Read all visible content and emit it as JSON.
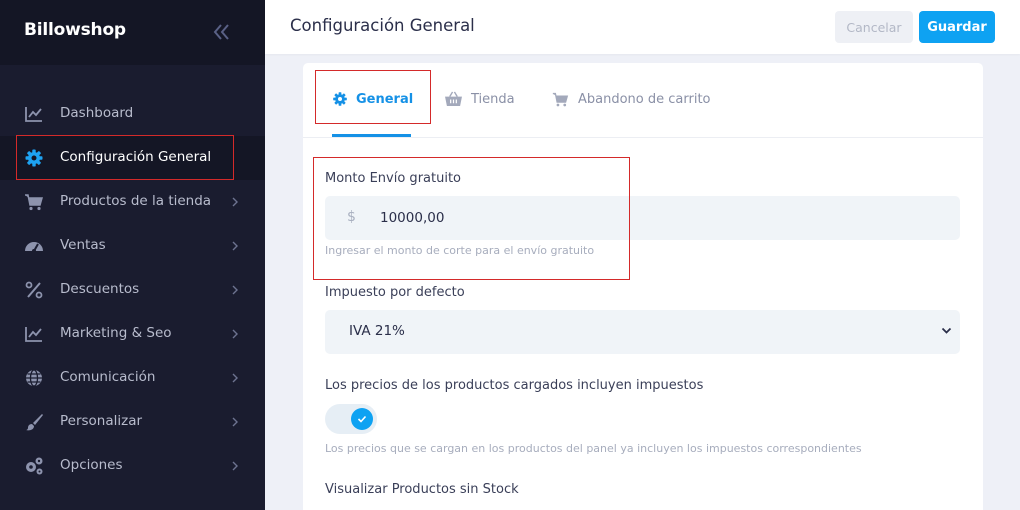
{
  "sidebar": {
    "brand": "Billowshop",
    "items": [
      {
        "label": "Dashboard",
        "icon": "chart-line-icon"
      },
      {
        "label": "Configuración General",
        "icon": "gear-icon"
      },
      {
        "label": "Productos de la tienda",
        "icon": "cart-icon"
      },
      {
        "label": "Ventas",
        "icon": "speedometer-icon"
      },
      {
        "label": "Descuentos",
        "icon": "percent-icon"
      },
      {
        "label": "Marketing & Seo",
        "icon": "chart-line-icon"
      },
      {
        "label": "Comunicación",
        "icon": "globe-icon"
      },
      {
        "label": "Personalizar",
        "icon": "brush-icon"
      },
      {
        "label": "Opciones",
        "icon": "gears-icon"
      }
    ],
    "active_index": 1
  },
  "header": {
    "title": "Configuración General",
    "cancel_label": "Cancelar",
    "save_label": "Guardar"
  },
  "tabs": [
    {
      "label": "General",
      "icon": "gear-icon",
      "active": true
    },
    {
      "label": "Tienda",
      "icon": "basket-icon",
      "active": false
    },
    {
      "label": "Abandono de carrito",
      "icon": "cart-icon",
      "active": false
    }
  ],
  "form": {
    "free_shipping": {
      "label": "Monto Envío gratuito",
      "currency_symbol": "$",
      "value": "10000,00",
      "help": "Ingresar el monto de corte para el envío gratuito"
    },
    "default_tax": {
      "label": "Impuesto por defecto",
      "selected": "IVA 21%"
    },
    "prices_include_tax": {
      "label": "Los precios de los productos cargados incluyen impuestos",
      "enabled": true,
      "help": "Los precios que se cargan en los productos del panel ya incluyen los impuestos correspondientes"
    },
    "show_out_of_stock": {
      "label": "Visualizar Productos sin Stock"
    }
  },
  "colors": {
    "sidebar_bg": "#1a1c2f",
    "accent": "#0ea2f2",
    "highlight_box": "#d42a2a"
  }
}
